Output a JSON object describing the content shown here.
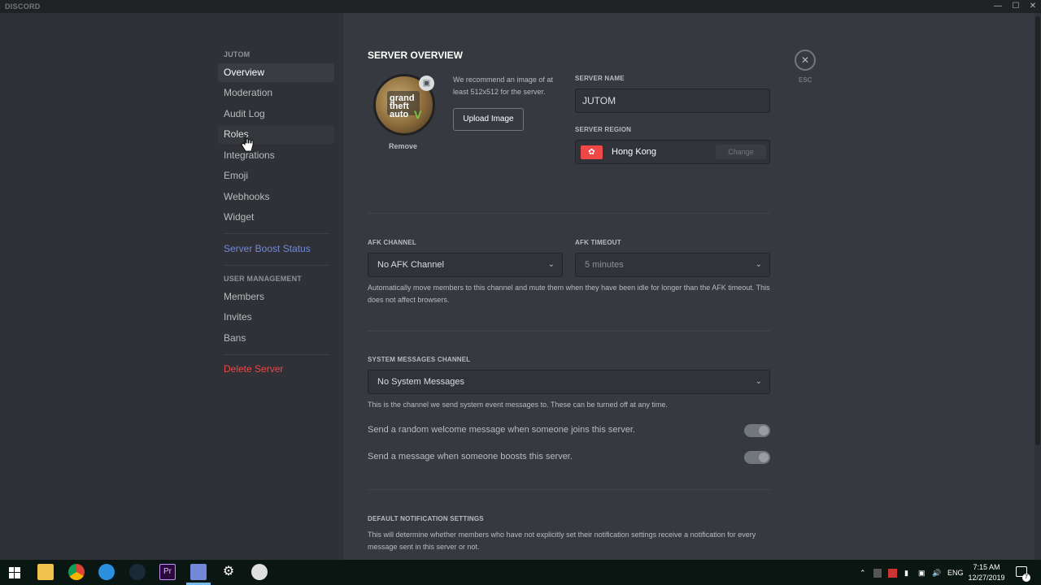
{
  "app": {
    "title": "DISCORD"
  },
  "sidebar": {
    "server_header": "JUTOM",
    "items": [
      {
        "label": "Overview"
      },
      {
        "label": "Moderation"
      },
      {
        "label": "Audit Log"
      },
      {
        "label": "Roles"
      },
      {
        "label": "Integrations"
      },
      {
        "label": "Emoji"
      },
      {
        "label": "Webhooks"
      },
      {
        "label": "Widget"
      }
    ],
    "boost": "Server Boost Status",
    "user_mgmt_header": "USER MANAGEMENT",
    "user_items": [
      {
        "label": "Members"
      },
      {
        "label": "Invites"
      },
      {
        "label": "Bans"
      }
    ],
    "delete": "Delete Server"
  },
  "main": {
    "title": "SERVER OVERVIEW",
    "esc_label": "ESC",
    "icon_hint": "We recommend an image of at least 512x512 for the server.",
    "upload_label": "Upload Image",
    "remove_label": "Remove",
    "server_name_label": "SERVER NAME",
    "server_name_value": "JUTOM",
    "server_region_label": "SERVER REGION",
    "server_region_value": "Hong Kong",
    "change_label": "Change",
    "afk_channel_label": "AFK CHANNEL",
    "afk_channel_value": "No AFK Channel",
    "afk_timeout_label": "AFK TIMEOUT",
    "afk_timeout_value": "5 minutes",
    "afk_desc": "Automatically move members to this channel and mute them when they have been idle for longer than the AFK timeout. This does not affect browsers.",
    "system_label": "SYSTEM MESSAGES CHANNEL",
    "system_value": "No System Messages",
    "system_desc": "This is the channel we send system event messages to. These can be turned off at any time.",
    "welcome_toggle": "Send a random welcome message when someone joins this server.",
    "boost_toggle": "Send a message when someone boosts this server.",
    "notif_label": "DEFAULT NOTIFICATION SETTINGS",
    "notif_desc": "This will determine whether members who have not explicitly set their notification settings receive a notification for every message sent in this server or not."
  },
  "colors": {
    "accent": "#7289da",
    "danger": "#f04747",
    "region_flag": "#f04747"
  },
  "taskbar": {
    "time": "7:15 AM",
    "date": "12/27/2019",
    "lang": "ENG",
    "notif_count": "7"
  }
}
